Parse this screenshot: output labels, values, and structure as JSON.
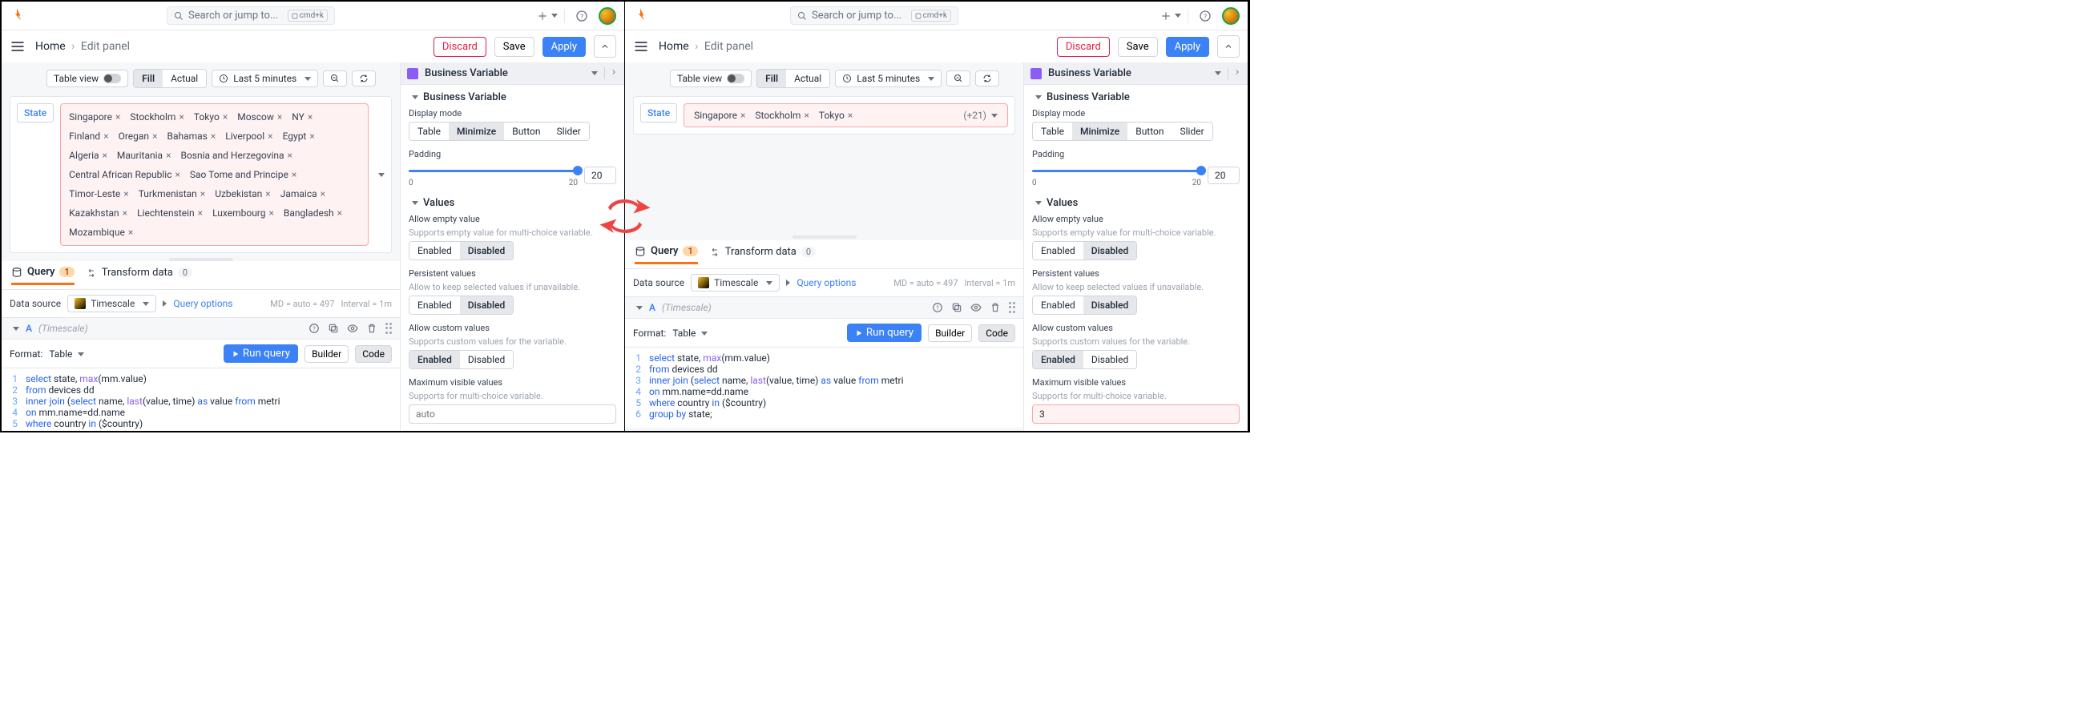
{
  "search": {
    "placeholder": "Search or jump to...",
    "kbd": "cmd+k"
  },
  "breadcrumb": {
    "home": "Home",
    "current": "Edit panel"
  },
  "buttons": {
    "discard": "Discard",
    "save": "Save",
    "apply": "Apply"
  },
  "ctrl": {
    "table_view": "Table view",
    "fill": "Fill",
    "actual": "Actual",
    "time_range": "Last 5 minutes"
  },
  "variable": {
    "label": "State",
    "chips_full": [
      "Singapore",
      "Stockholm",
      "Tokyo",
      "Moscow",
      "NY",
      "Finland",
      "Oregan",
      "Bahamas",
      "Liverpool",
      "Egypt",
      "Algeria",
      "Mauritania",
      "Bosnia and Herzegovina",
      "Central African Republic",
      "Sao Tome and Principe",
      "Timor-Leste",
      "Turkmenistan",
      "Uzbekistan",
      "Jamaica",
      "Kazakhstan",
      "Liechtenstein",
      "Luxembourg",
      "Bangladesh",
      "Mozambique"
    ],
    "chips_min": [
      "Singapore",
      "Stockholm",
      "Tokyo"
    ],
    "more": "(+21)"
  },
  "tabs": {
    "query": "Query",
    "query_n": "1",
    "transform": "Transform data",
    "transform_n": "0"
  },
  "ds": {
    "label": "Data source",
    "name": "Timescale",
    "query_options": "Query options",
    "md": "MD = auto = 497",
    "interval": "Interval = 1m"
  },
  "qhead": {
    "letter": "A",
    "ds": "(Timescale)"
  },
  "format": {
    "label": "Format:",
    "value": "Table",
    "run": "Run query",
    "builder": "Builder",
    "code": "Code"
  },
  "code": {
    "lines": [
      {
        "n": "1",
        "t": "select state, max(mm.value)",
        "h": [
          "kw",
          "",
          "",
          "fn",
          ""
        ]
      },
      {
        "n": "2",
        "t": "from devices dd"
      },
      {
        "n": "3",
        "t": "inner join (select name, last(value, time) as value from metri"
      },
      {
        "n": "4",
        "t": "on mm.name=dd.name"
      },
      {
        "n": "5",
        "t": "where country in ($country)"
      },
      {
        "n": "6",
        "t": "group by state;"
      }
    ]
  },
  "side": {
    "title": "Business Variable",
    "section_bv": "Business Variable",
    "display_mode": "Display mode",
    "modes": [
      "Table",
      "Minimize",
      "Button",
      "Slider"
    ],
    "padding": "Padding",
    "pad_min": "0",
    "pad_max": "20",
    "pad_val": "20",
    "section_values": "Values",
    "allow_empty": "Allow empty value",
    "allow_empty_hint": "Supports empty value for multi-choice variable.",
    "persistent": "Persistent values",
    "persistent_hint": "Allow to keep selected values if unavailable.",
    "custom": "Allow custom values",
    "custom_hint": "Supports custom values for the variable.",
    "max_visible": "Maximum visible values",
    "max_visible_hint": "Supports for multi-choice variable.",
    "enabled": "Enabled",
    "disabled": "Disabled",
    "auto_ph": "auto",
    "max_val": "3"
  }
}
